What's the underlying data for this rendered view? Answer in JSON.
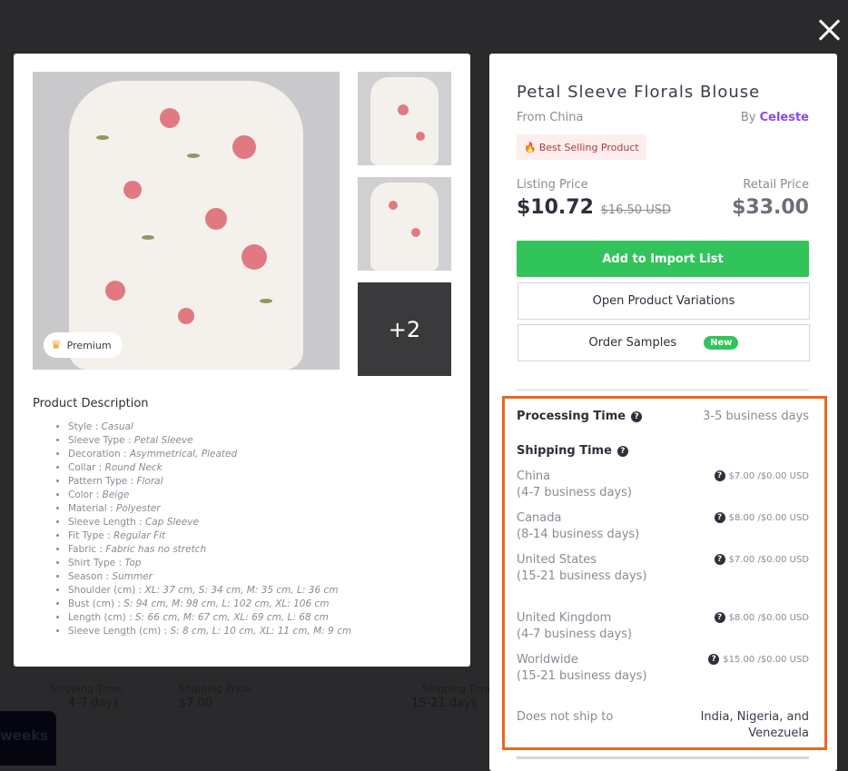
{
  "background": {
    "shipping_time_label": "Shipping Time:",
    "shipping_time_1": "4-7 days",
    "shipping_price_label": "Shipping Price:",
    "shipping_price": "$7.00",
    "shipping_time_2": "15-21 days",
    "weeks": "weeks"
  },
  "gallery": {
    "premium_label": "Premium",
    "more_label": "+2"
  },
  "description": {
    "title": "Product Description",
    "items": [
      {
        "k": "Style",
        "v": "Casual"
      },
      {
        "k": "Sleeve Type",
        "v": "Petal Sleeve"
      },
      {
        "k": "Decoration",
        "v": "Asymmetrical, Pleated"
      },
      {
        "k": "Collar",
        "v": "Round Neck"
      },
      {
        "k": "Pattern Type",
        "v": "Floral"
      },
      {
        "k": "Color",
        "v": "Beige"
      },
      {
        "k": "Material",
        "v": "Polyester"
      },
      {
        "k": "Sleeve Length",
        "v": "Cap Sleeve"
      },
      {
        "k": "Fit Type",
        "v": "Regular Fit"
      },
      {
        "k": "Fabric",
        "v": "Fabric has no stretch"
      },
      {
        "k": "Shirt Type",
        "v": "Top"
      },
      {
        "k": "Season",
        "v": "Summer"
      },
      {
        "k": "Shoulder (cm)",
        "v": "XL: 37 cm, S: 34 cm, M: 35 cm, L: 36 cm"
      },
      {
        "k": "Bust (cm)",
        "v": "S: 94 cm, M: 98 cm, L: 102 cm, XL: 106 cm"
      },
      {
        "k": "Length (cm)",
        "v": "S: 66 cm, M: 67 cm, XL: 69 cm, L: 68 cm"
      },
      {
        "k": "Sleeve Length (cm)",
        "v": "S: 8 cm, L: 10 cm, XL: 11 cm, M: 9 cm"
      }
    ]
  },
  "product": {
    "title": "Petal Sleeve Florals Blouse",
    "from": "From China",
    "by": "By",
    "seller": "Celeste",
    "badge": "Best Selling Product",
    "listing_label": "Listing Price",
    "listing_price": "$10.72",
    "original_price": "$16.50 USD",
    "retail_label": "Retail Price",
    "retail_price": "$33.00",
    "add_button": "Add to Import List",
    "variations_button": "Open Product Variations",
    "samples_button": "Order Samples",
    "new_badge": "New",
    "accent": "#31c45a",
    "seller_color": "#8a4af3"
  },
  "shipping": {
    "processing_label": "Processing Time",
    "processing_value": "3-5 business days",
    "shipping_label": "Shipping Time",
    "rows": [
      {
        "country": "China",
        "time": "(4-7 business days)",
        "cost": "$7.00 /$0.00 USD"
      },
      {
        "country": "Canada",
        "time": "(8-14 business days)",
        "cost": "$8.00 /$0.00 USD"
      },
      {
        "country": "United States",
        "time": "(15-21 business days)",
        "cost": "$7.00 /$0.00 USD"
      },
      {
        "country": "United Kingdom",
        "time": "(4-7 business days)",
        "cost": "$8.00 /$0.00 USD"
      },
      {
        "country": "Worldwide",
        "time": "(15-21 business days)",
        "cost": "$15.00 /$0.00 USD"
      }
    ],
    "no_ship_label": "Does not ship to",
    "no_ship_value": "India, Nigeria, and Venezuela",
    "highlight_color": "#e8681e"
  }
}
